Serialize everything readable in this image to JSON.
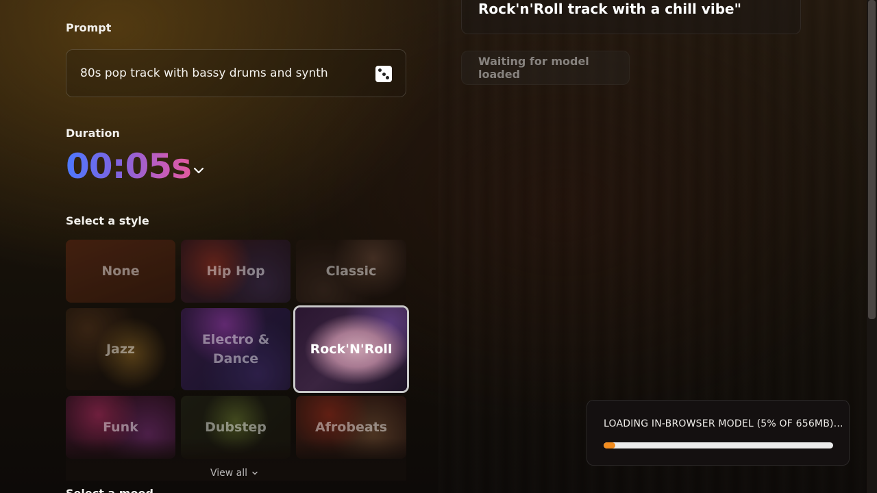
{
  "prompt": {
    "label": "Prompt",
    "value": "80s pop track with bassy drums and synth",
    "dice_icon": "dice-icon"
  },
  "duration": {
    "label": "Duration",
    "value": "00:05s",
    "chevron_icon": "chevron-down-icon"
  },
  "style": {
    "label": "Select a style",
    "selected": "Rock'N'Roll",
    "items": [
      {
        "label": "None"
      },
      {
        "label": "Hip Hop"
      },
      {
        "label": "Classic"
      },
      {
        "label": "Jazz"
      },
      {
        "label": "Electro & Dance"
      },
      {
        "label": "Rock'N'Roll"
      },
      {
        "label": "Funk"
      },
      {
        "label": "Dubstep"
      },
      {
        "label": "Afrobeats"
      }
    ],
    "view_all": "View all"
  },
  "mood": {
    "label": "Select a mood"
  },
  "result": {
    "text": "Rock'n'Roll track with a chill vibe\""
  },
  "status": {
    "waiting": "Waiting for model loaded"
  },
  "loader": {
    "text": "LOADING IN-BROWSER MODEL (5% OF 656MB)...",
    "progress": 0.05,
    "bar_color": "#f28c1f"
  },
  "colors": {
    "duration_gradient_start": "#4d79ff",
    "duration_gradient_end": "#e15a9c"
  }
}
